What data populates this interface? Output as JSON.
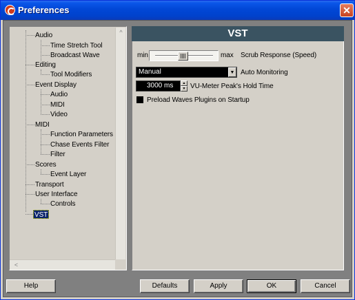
{
  "window": {
    "title": "Preferences",
    "close_glyph": "✕",
    "app_icon": "cubase-icon",
    "colors": {
      "titlebar": "#0042cc",
      "header": "#3a5361",
      "selection": "#0a246a"
    }
  },
  "tree": {
    "items": [
      {
        "label": "Audio"
      },
      {
        "label": "Time Stretch Tool"
      },
      {
        "label": "Broadcast Wave"
      },
      {
        "label": "Editing"
      },
      {
        "label": "Tool Modifiers"
      },
      {
        "label": "Event Display"
      },
      {
        "label": "Audio"
      },
      {
        "label": "MIDI"
      },
      {
        "label": "Video"
      },
      {
        "label": "MIDI"
      },
      {
        "label": "Function Parameters"
      },
      {
        "label": "Chase Events Filter"
      },
      {
        "label": "Filter"
      },
      {
        "label": "Scores"
      },
      {
        "label": "Event Layer"
      },
      {
        "label": "Transport"
      },
      {
        "label": "User Interface"
      },
      {
        "label": "Controls"
      },
      {
        "label": "VST"
      }
    ],
    "scroll_left": "<",
    "scroll_up": "^"
  },
  "panel": {
    "title": "VST",
    "scrub": {
      "min_label": "min",
      "max_label": "max",
      "label": "Scrub Response (Speed)",
      "level": 0.45
    },
    "auto_monitoring": {
      "value": "Manual",
      "label": "Auto Monitoring",
      "arrow": "▼"
    },
    "vu_hold": {
      "value": "3000 ms",
      "label": "VU-Meter Peak's Hold Time",
      "up": "▲",
      "down": "▼"
    },
    "preload": {
      "label": "Preload Waves Plugins on Startup",
      "checked": false
    }
  },
  "buttons": {
    "help": "Help",
    "defaults": "Defaults",
    "apply": "Apply",
    "ok": "OK",
    "cancel": "Cancel"
  }
}
